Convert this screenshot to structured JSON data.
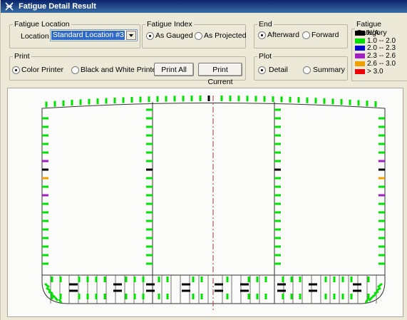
{
  "window": {
    "title": "Fatigue Detail Result"
  },
  "fatigue_location": {
    "legend": "Fatigue Location",
    "location_label": "Location",
    "selected": "Standard Location #3"
  },
  "fatigue_index": {
    "legend": "Fatigue Index",
    "options": [
      "As Gauged",
      "As Projected"
    ],
    "selected": "As Gauged"
  },
  "end": {
    "legend": "End",
    "options": [
      "Afterward",
      "Forward"
    ],
    "selected": "Afterward"
  },
  "print": {
    "legend": "Print",
    "options": [
      "Color Printer",
      "Black and White Printer"
    ],
    "selected": "Color Printer",
    "print_all": "Print All",
    "print_current": "Print Current"
  },
  "plot": {
    "legend": "Plot",
    "options": [
      "Detail",
      "Summary"
    ],
    "selected": "Detail"
  },
  "fatigue_category": {
    "legend": "Fatigue Category",
    "items": [
      {
        "label": "N/A",
        "color": "#000000"
      },
      {
        "label": "1.0 -- 2.0",
        "color": "#00e000"
      },
      {
        "label": "2.0 -- 2.3",
        "color": "#0000cc"
      },
      {
        "label": "2.3 -- 2.6",
        "color": "#a020c0"
      },
      {
        "label": "2.6 -- 3.0",
        "color": "#f0a000"
      },
      {
        "label": "> 3.0",
        "color": "#ee0000"
      }
    ]
  },
  "colors": {
    "green": "#00e000",
    "black": "#000000",
    "blue": "#0000cc",
    "purple": "#a020c0",
    "orange": "#f0a000",
    "centerline": "#a03030"
  }
}
